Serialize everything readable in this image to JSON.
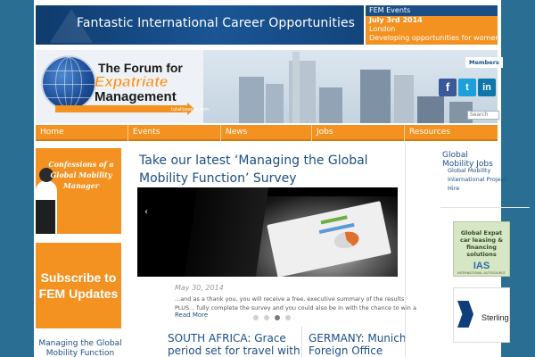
{
  "banner": {
    "text": "Fantastic International Career Opportunities"
  },
  "events": {
    "title": "FEM Events",
    "date": "July 3rd 2014",
    "city": "London",
    "desc": "Developing opportunities for women"
  },
  "header": {
    "logo_line1": "The Forum for",
    "logo_line2": "Expatriate",
    "logo_line3": "Management",
    "logo_url": "totallyexpat.com",
    "members_label": "Members",
    "social": [
      "f",
      "t",
      "in"
    ],
    "search_placeholder": "Search"
  },
  "nav": {
    "items": [
      "Home",
      "Events",
      "News",
      "Jobs",
      "Resources"
    ]
  },
  "left": {
    "confessions_text": "Confessions of a Global Mobility Manager",
    "subscribe_text": "Subscribe to FEM Updates",
    "link": "Managing the Global Mobility Function"
  },
  "main": {
    "title": "Take our latest ‘Managing the Global Mobility Function’ Survey",
    "date": "May 30, 2014",
    "excerpt": "...and as a thank you, you will receive a free, executive summary of the results! PLUS… fully complete the survey and you could also be in with the chance to win a",
    "read_more": "Read More",
    "prev_arrow": "‹",
    "next_arrow": "›",
    "slides_total": 4,
    "slide_active": 3
  },
  "news": [
    {
      "title": "SOUTH AFRICA: Grace period set for travel with"
    },
    {
      "title": "GERMANY: Munich Foreign Office"
    }
  ],
  "right": {
    "jobs_heading": "Global Mobility Jobs",
    "jobs_item": "Global Mobility International Project-Hire",
    "ad_ias_text": "Global Expat car leasing & financing solutions",
    "ad_ias_logo": "IAS",
    "ad_ias_sub": "INTERNATIONAL AUTOSOURCE",
    "ad_sterling": "Sterling"
  },
  "colors": {
    "brand_blue": "#1b4e84",
    "accent_orange": "#f39220",
    "page_bg": "#2a6f93"
  },
  "icons": [
    "globe-logo-icon",
    "facebook-icon",
    "twitter-icon",
    "linkedin-icon",
    "prev-arrow-icon",
    "next-arrow-icon",
    "sterling-logo-icon"
  ]
}
